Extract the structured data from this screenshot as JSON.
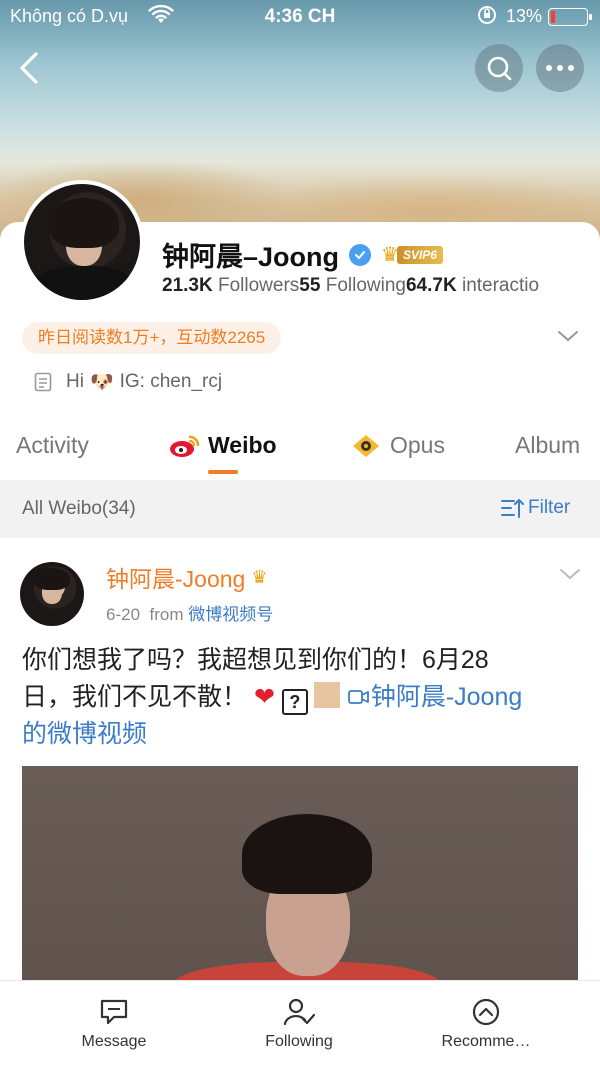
{
  "status_bar": {
    "carrier": "Không có D.vụ",
    "time": "4:36 CH",
    "battery_percent": "13%",
    "battery_level": 0.13
  },
  "profile": {
    "name": "钟阿晨–Joong",
    "svip_tag": "SVIP6",
    "followers_count": "21.3K",
    "followers_label": "Followers",
    "following_count": "55",
    "following_label": "Following",
    "interactions_count": "64.7K",
    "interactions_label": "interactio",
    "read_stats": "昨日阅读数1万+，互动数2265",
    "bio_prefix": "Hi",
    "bio_suffix": "IG: chen_rcj"
  },
  "tabs": [
    {
      "label": "Activity"
    },
    {
      "label": "Weibo"
    },
    {
      "label": "Opus"
    },
    {
      "label": "Album"
    }
  ],
  "filter_bar": {
    "count_label": "All Weibo(34)",
    "filter_label": "Filter"
  },
  "post": {
    "author": "钟阿晨-Joong",
    "date": "6-20",
    "from_label": "from",
    "source": "微博视频号",
    "text_line1": "你们想我了吗？我超想见到你们的！6月28",
    "text_line2_start": "日，我们不见不散！",
    "qbox": "?",
    "link_text": "钟阿晨-Joong",
    "link_text_cont": "的微博视频"
  },
  "bottom_bar": [
    {
      "label": "Message",
      "icon": "message-icon"
    },
    {
      "label": "Following",
      "icon": "user-check-icon"
    },
    {
      "label": "Recomme…",
      "icon": "chevron-up-circle-icon"
    }
  ],
  "colors": {
    "accent_orange": "#f07d23",
    "link_blue": "#3c7cc9",
    "verified_blue": "#4a9ff0"
  }
}
